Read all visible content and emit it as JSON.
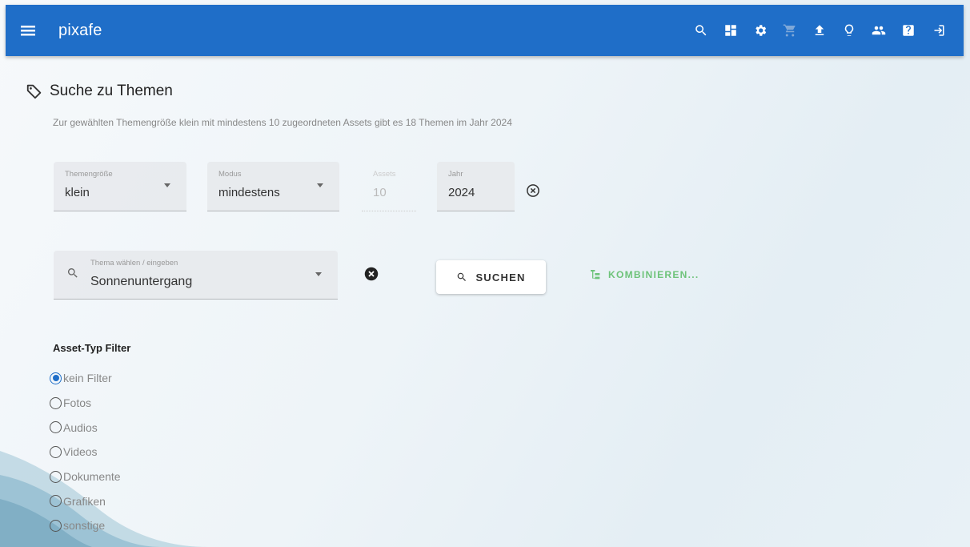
{
  "topbar": {
    "app_title": "pixafe",
    "icons": [
      "search-icon",
      "dashboard-icon",
      "settings-icon",
      "cart-icon",
      "upload-icon",
      "lightbulb-icon",
      "users-icon",
      "help-icon",
      "logout-icon"
    ],
    "color": "#1f6ec8"
  },
  "header": {
    "title": "Suche zu Themen",
    "subtitle": "Zur gewählten Themengröße klein mit mindestens 10 zugeordneten Assets gibt es 18 Themen im Jahr 2024"
  },
  "filters": {
    "themengroesse": {
      "label": "Themengröße",
      "value": "klein"
    },
    "modus": {
      "label": "Modus",
      "value": "mindestens"
    },
    "assets": {
      "label": "Assets",
      "value": "10"
    },
    "jahr": {
      "label": "Jahr",
      "value": "2024"
    }
  },
  "theme_search": {
    "label": "Thema wählen / eingeben",
    "value": "Sonnenuntergang"
  },
  "buttons": {
    "search": "SUCHEN",
    "combine": "KOMBINIEREN..."
  },
  "asset_filter": {
    "title": "Asset-Typ Filter",
    "options": [
      {
        "label": "kein Filter",
        "checked": true
      },
      {
        "label": "Fotos",
        "checked": false
      },
      {
        "label": "Audios",
        "checked": false
      },
      {
        "label": "Videos",
        "checked": false
      },
      {
        "label": "Dokumente",
        "checked": false
      },
      {
        "label": "Grafiken",
        "checked": false
      },
      {
        "label": "sonstige",
        "checked": false
      }
    ]
  },
  "colors": {
    "accent": "#1f6ec8",
    "combine": "#6ec37a"
  }
}
